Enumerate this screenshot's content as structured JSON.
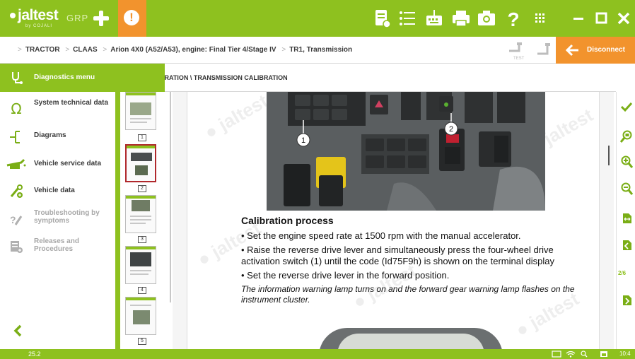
{
  "app": {
    "logo": "jaltest",
    "logo_sub": "by COJALI",
    "grp": "GRP"
  },
  "breadcrumb": {
    "items": [
      "TRACTOR",
      "CLAAS",
      "Arion 4X0 (A52/A53), engine: Final Tier 4/Stage IV",
      "TR1, Transmission"
    ]
  },
  "disconnect_label": "Disconnect",
  "toolbar": {
    "test_label": "TEST"
  },
  "sidebar": {
    "title": "Diagnostics menu",
    "items": [
      {
        "label": "System technical data"
      },
      {
        "label": "Diagrams"
      },
      {
        "label": "Vehicle service data"
      },
      {
        "label": "Vehicle data"
      },
      {
        "label": "Troubleshooting by symptoms"
      },
      {
        "label": "Releases and Procedures"
      }
    ]
  },
  "header": {
    "title": "CALIBRATION \\ TRANSMISSION CALIBRATION"
  },
  "thumbnails": [
    "1",
    "2",
    "3",
    "4",
    "5"
  ],
  "document": {
    "callouts": [
      "1",
      "2"
    ],
    "heading": "Calibration process",
    "bullet1": "• Set the engine speed rate at 1500 rpm with the manual accelerator.",
    "bullet2": "• Raise the reverse drive lever and simultaneously press the four-wheel drive activation switch (1) until the code (Id75F9h) is shown on the terminal display",
    "bullet3": "• Set the reverse drive lever in the forward position.",
    "note": "The information warning lamp turns on and the forward gear warning lamp flashes on the instrument cluster."
  },
  "page_indicator": "2/6",
  "status": {
    "version": "25.2",
    "clock": "10:4"
  },
  "colors": {
    "brand_green": "#8ec11f",
    "accent_orange": "#f2932d",
    "selected_thumb": "#b0282c"
  }
}
